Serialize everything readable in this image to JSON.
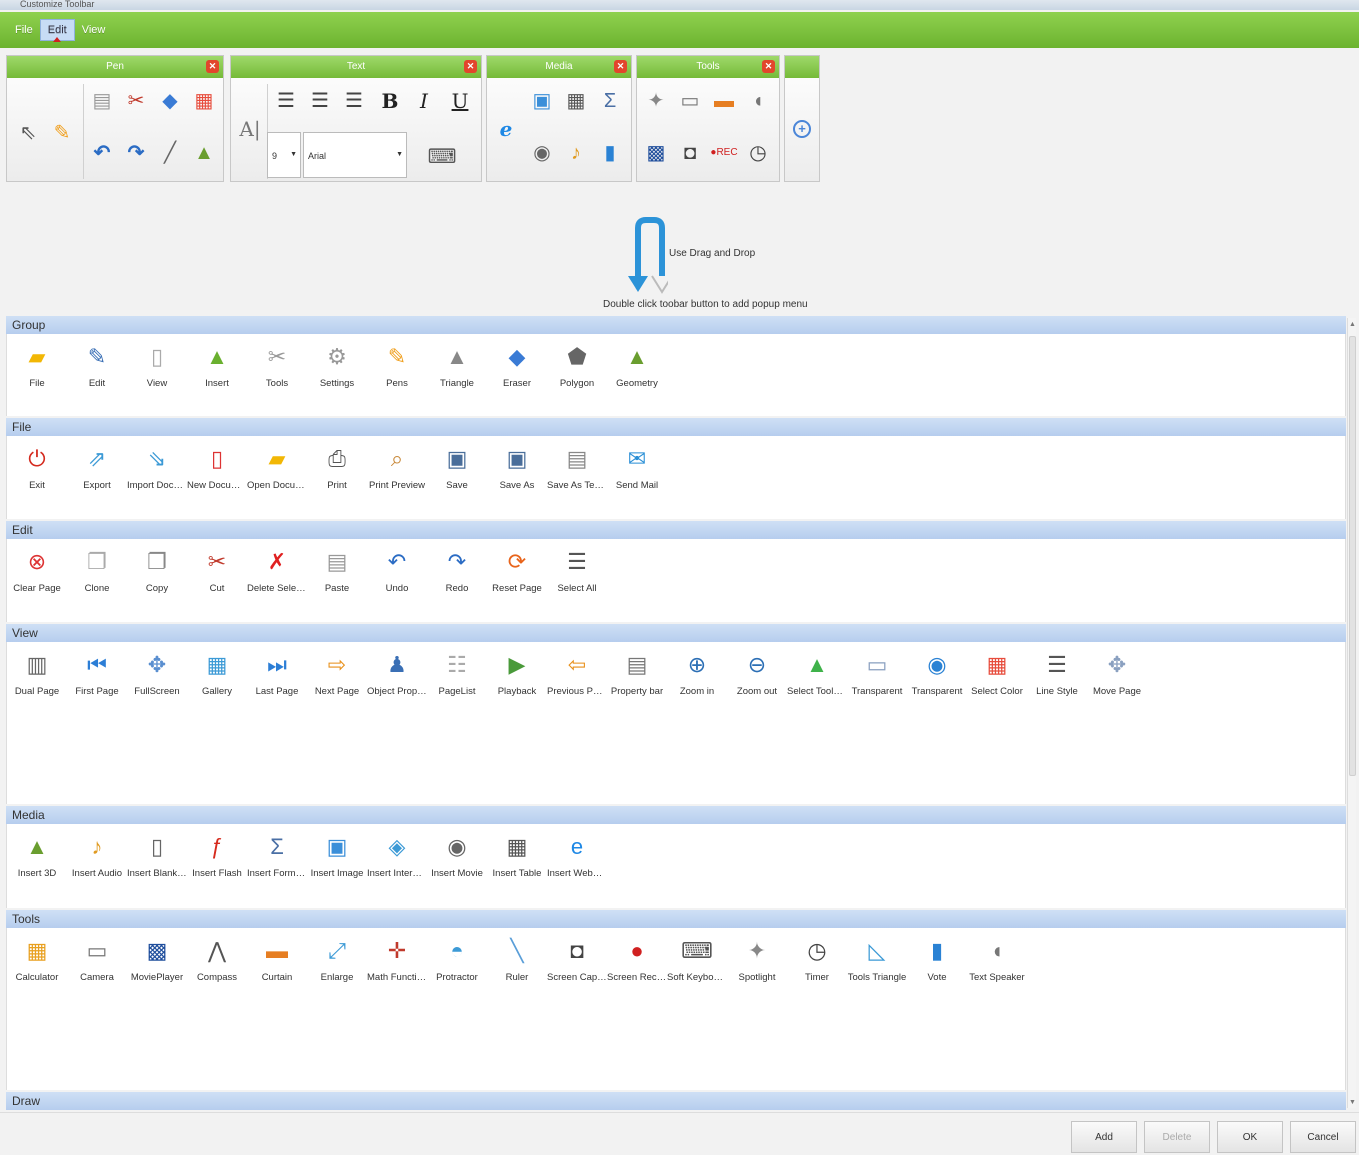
{
  "window": {
    "title": "Customize Toolbar"
  },
  "menu": [
    {
      "label": "File"
    },
    {
      "label": "Edit"
    },
    {
      "label": "View"
    }
  ],
  "panels": {
    "pen": {
      "title": "Pen"
    },
    "text": {
      "title": "Text",
      "font_size": "9",
      "font_name": "Arial"
    },
    "media": {
      "title": "Media"
    },
    "tools": {
      "title": "Tools"
    }
  },
  "drag_hint": {
    "line1": "Use Drag and Drop",
    "line2": "Double click toobar button to add popup menu"
  },
  "sections": {
    "group": {
      "title": "Group",
      "items": [
        {
          "label": "File",
          "icon": "folder-icon"
        },
        {
          "label": "Edit",
          "icon": "edit-icon"
        },
        {
          "label": "View",
          "icon": "view-icon"
        },
        {
          "label": "Insert",
          "icon": "insert-icon"
        },
        {
          "label": "Tools",
          "icon": "tools-icon"
        },
        {
          "label": "Settings",
          "icon": "settings-icon"
        },
        {
          "label": "Pens",
          "icon": "pen-icon"
        },
        {
          "label": "Triangle",
          "icon": "triangle-icon"
        },
        {
          "label": "Eraser",
          "icon": "eraser-icon"
        },
        {
          "label": "Polygon",
          "icon": "polygon-icon"
        },
        {
          "label": "Geometry",
          "icon": "geometry-icon"
        }
      ]
    },
    "file": {
      "title": "File",
      "items": [
        {
          "label": "Exit",
          "icon": "power-icon"
        },
        {
          "label": "Export",
          "icon": "export-icon"
        },
        {
          "label": "Import Docum...",
          "icon": "import-icon"
        },
        {
          "label": "New Document",
          "icon": "new-document-icon"
        },
        {
          "label": "Open Document",
          "icon": "open-document-icon"
        },
        {
          "label": "Print",
          "icon": "print-icon"
        },
        {
          "label": "Print Preview",
          "icon": "print-preview-icon"
        },
        {
          "label": "Save",
          "icon": "save-icon"
        },
        {
          "label": "Save As",
          "icon": "save-as-icon"
        },
        {
          "label": "Save As Tem...",
          "icon": "save-template-icon"
        },
        {
          "label": "Send Mail",
          "icon": "mail-icon"
        }
      ]
    },
    "edit": {
      "title": "Edit",
      "items": [
        {
          "label": "Clear Page",
          "icon": "clear-page-icon"
        },
        {
          "label": "Clone",
          "icon": "clone-icon"
        },
        {
          "label": "Copy",
          "icon": "copy-icon"
        },
        {
          "label": "Cut",
          "icon": "scissors-icon"
        },
        {
          "label": "Delete Selected",
          "icon": "delete-icon"
        },
        {
          "label": "Paste",
          "icon": "paste-icon"
        },
        {
          "label": "Undo",
          "icon": "undo-icon"
        },
        {
          "label": "Redo",
          "icon": "redo-icon"
        },
        {
          "label": "Reset Page",
          "icon": "reset-icon"
        },
        {
          "label": "Select All",
          "icon": "select-all-icon"
        }
      ]
    },
    "view": {
      "title": "View",
      "items": [
        {
          "label": "Dual Page",
          "icon": "book-icon"
        },
        {
          "label": "First Page",
          "icon": "first-page-icon"
        },
        {
          "label": "FullScreen",
          "icon": "fullscreen-icon"
        },
        {
          "label": "Gallery",
          "icon": "gallery-icon"
        },
        {
          "label": "Last Page",
          "icon": "last-page-icon"
        },
        {
          "label": "Next Page",
          "icon": "next-page-icon"
        },
        {
          "label": "Object Property",
          "icon": "object-property-icon"
        },
        {
          "label": "PageList",
          "icon": "page-list-icon"
        },
        {
          "label": "Playback",
          "icon": "playback-icon"
        },
        {
          "label": "Previous Page",
          "icon": "previous-page-icon"
        },
        {
          "label": "Property bar",
          "icon": "property-bar-icon"
        },
        {
          "label": "Zoom in",
          "icon": "zoom-in-icon"
        },
        {
          "label": "Zoom out",
          "icon": "zoom-out-icon"
        },
        {
          "label": "Select Toolba...",
          "icon": "select-toolbar-icon"
        },
        {
          "label": "Transparent",
          "icon": "transparent-icon"
        },
        {
          "label": "Transparent",
          "icon": "transparent-ie-icon"
        },
        {
          "label": "Select Color",
          "icon": "color-palette-icon"
        },
        {
          "label": "Line Style",
          "icon": "line-style-icon"
        },
        {
          "label": "Move Page",
          "icon": "move-page-icon"
        }
      ]
    },
    "media": {
      "title": "Media",
      "items": [
        {
          "label": "Insert 3D",
          "icon": "insert-3d-icon"
        },
        {
          "label": "Insert Audio",
          "icon": "audio-icon"
        },
        {
          "label": "Insert Blank P...",
          "icon": "blank-page-icon"
        },
        {
          "label": "Insert Flash",
          "icon": "flash-icon"
        },
        {
          "label": "Insert Formula",
          "icon": "formula-icon"
        },
        {
          "label": "Insert Image",
          "icon": "image-icon"
        },
        {
          "label": "Insert Internet...",
          "icon": "internet-icon"
        },
        {
          "label": "Insert Movie",
          "icon": "movie-icon"
        },
        {
          "label": "Insert Table",
          "icon": "table-icon"
        },
        {
          "label": "Insert WebBr...",
          "icon": "web-browser-icon"
        }
      ]
    },
    "tools": {
      "title": "Tools",
      "items": [
        {
          "label": "Calculator",
          "icon": "calculator-icon"
        },
        {
          "label": "Camera",
          "icon": "camera-icon"
        },
        {
          "label": "MoviePlayer",
          "icon": "movie-player-icon"
        },
        {
          "label": "Compass",
          "icon": "compass-icon"
        },
        {
          "label": "Curtain",
          "icon": "curtain-icon"
        },
        {
          "label": "Enlarge",
          "icon": "enlarge-icon"
        },
        {
          "label": "Math Function",
          "icon": "math-function-icon"
        },
        {
          "label": "Protractor",
          "icon": "protractor-icon"
        },
        {
          "label": "Ruler",
          "icon": "ruler-icon"
        },
        {
          "label": "Screen Capture",
          "icon": "screen-capture-icon"
        },
        {
          "label": "Screen Record",
          "icon": "screen-record-icon"
        },
        {
          "label": "Soft Keyboard",
          "icon": "keyboard-icon"
        },
        {
          "label": "Spotlight",
          "icon": "spotlight-icon"
        },
        {
          "label": "Timer",
          "icon": "timer-icon"
        },
        {
          "label": "Tools Triangle",
          "icon": "tools-triangle-icon"
        },
        {
          "label": "Vote",
          "icon": "vote-icon"
        },
        {
          "label": "Text Speaker",
          "icon": "text-speaker-icon"
        }
      ]
    },
    "draw": {
      "title": "Draw"
    }
  },
  "buttons": {
    "add": "Add",
    "delete": "Delete",
    "ok": "OK",
    "cancel": "Cancel"
  }
}
